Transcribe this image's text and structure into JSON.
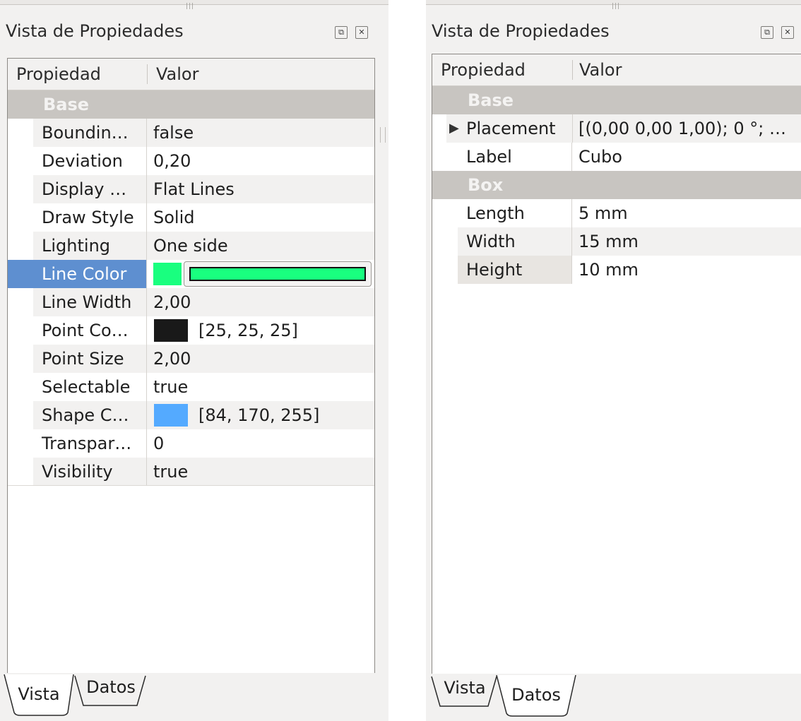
{
  "left_panel": {
    "title": "Vista de Propiedades",
    "header": {
      "col1": "Propiedad",
      "col2": "Valor"
    },
    "group": "Base",
    "rows": [
      {
        "name": "Boundin…",
        "value": "false"
      },
      {
        "name": "Deviation",
        "value": "0,20"
      },
      {
        "name": "Display …",
        "value": "Flat Lines"
      },
      {
        "name": "Draw Style",
        "value": "Solid"
      },
      {
        "name": "Lighting",
        "value": "One side"
      },
      {
        "name": "Line Color",
        "value": ""
      },
      {
        "name": "Line Width",
        "value": "2,00"
      },
      {
        "name": "Point Co…",
        "value": "[25, 25, 25]"
      },
      {
        "name": "Point Size",
        "value": "2,00"
      },
      {
        "name": "Selectable",
        "value": "true"
      },
      {
        "name": "Shape C…",
        "value": "[84, 170, 255]"
      },
      {
        "name": "Transpar…",
        "value": "0"
      },
      {
        "name": "Visibility",
        "value": "true"
      }
    ],
    "tabs": [
      "Vista",
      "Datos"
    ],
    "active_tab": "Vista"
  },
  "right_panel": {
    "title": "Vista de Propiedades",
    "header": {
      "col1": "Propiedad",
      "col2": "Valor"
    },
    "groups": [
      {
        "name": "Base",
        "rows": [
          {
            "name": "Placement",
            "value": "[(0,00 0,00 1,00); 0 °; …"
          },
          {
            "name": "Label",
            "value": "Cubo"
          }
        ]
      },
      {
        "name": "Box",
        "rows": [
          {
            "name": "Length",
            "value": "5 mm"
          },
          {
            "name": "Width",
            "value": "15 mm"
          },
          {
            "name": "Height",
            "value": "10 mm"
          }
        ]
      }
    ],
    "tabs": [
      "Vista",
      "Datos"
    ],
    "active_tab": "Datos"
  },
  "colors": {
    "line_color": "#19ff7f",
    "point_color": "#191919",
    "shape_color": "#54aaff",
    "selection": "#5e8fd0",
    "group_row": "#c8c5c1"
  },
  "icons": {
    "float": "float-icon",
    "close": "close-icon",
    "expand": "expand-triangle-icon",
    "grip": "grip-icon"
  }
}
